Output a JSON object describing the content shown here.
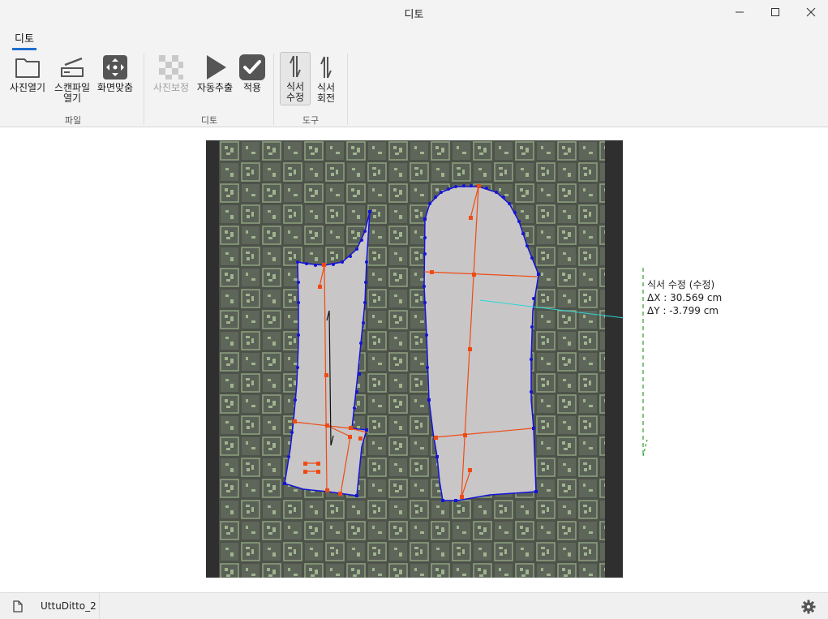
{
  "window": {
    "title": "디토",
    "controls": [
      "minimize-icon",
      "maximize-icon",
      "close-icon"
    ]
  },
  "ribbon": {
    "tab_label": "디토",
    "buttons": {
      "open_photo": "사진열기",
      "open_scan_line1": "스캔파일",
      "open_scan_line2": "열기",
      "fit_screen": "화면맞춤",
      "photo_correct": "사진보정",
      "auto_extract": "자동추출",
      "apply": "적용",
      "grain_edit_line1": "식서",
      "grain_edit_line2": "수정",
      "grain_rotate_line1": "식서",
      "grain_rotate_line2": "회전"
    },
    "groups": {
      "file": "파일",
      "ditto": "디토",
      "tools": "도구"
    }
  },
  "annotation": {
    "title": "식서 수정 (수정)",
    "dx": "ΔX : 30.569 cm",
    "dy": "ΔY : -3.799 cm"
  },
  "status": {
    "file_name": "UttuDitto_2"
  },
  "colors": {
    "accent": "#1f6fd0",
    "outline": "#1414d6",
    "construction": "#f04a14",
    "measure_line": "#2ad6d6",
    "guide": "#2f9e2f",
    "mat_dark": "#4d524a",
    "mat_light": "#8ea37e",
    "pattern_fill": "#c8c6c7"
  }
}
